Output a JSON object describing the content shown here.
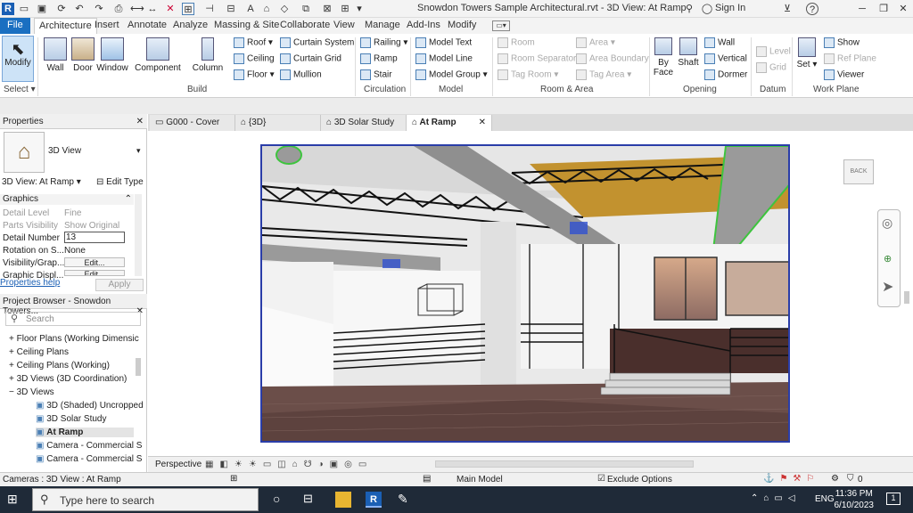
{
  "titlebar": {
    "title": "Snowdon Towers Sample Architectural.rvt - 3D View: At Ramp",
    "signin": "Sign In",
    "help": "?"
  },
  "tabs": [
    "File",
    "Architecture",
    "Insert",
    "Annotate",
    "Analyze",
    "Massing & Site",
    "Collaborate",
    "View",
    "Manage",
    "Add-Ins",
    "Modify"
  ],
  "ribbon": {
    "modify": "Modify",
    "select": "Select",
    "build": {
      "wall": "Wall",
      "door": "Door",
      "window": "Window",
      "component": "Component",
      "column": "Column",
      "roof": "Roof",
      "ceiling": "Ceiling",
      "floor": "Floor",
      "curtain_system": "Curtain System",
      "curtain_grid": "Curtain Grid",
      "mullion": "Mullion",
      "label": "Build"
    },
    "circulation": {
      "railing": "Railing",
      "ramp": "Ramp",
      "stair": "Stair",
      "label": "Circulation"
    },
    "model": {
      "text": "Model Text",
      "line": "Model Line",
      "group": "Model Group",
      "label": "Model"
    },
    "room": {
      "room": "Room",
      "separator": "Room Separator",
      "tag": "Tag Room",
      "area": "Area",
      "boundary": "Area Boundary",
      "tag_area": "Tag Area",
      "label": "Room & Area"
    },
    "opening": {
      "by_face_1": "By",
      "by_face_2": "Face",
      "shaft": "Shaft",
      "wall": "Wall",
      "vertical": "Vertical",
      "dormer": "Dormer",
      "label": "Opening"
    },
    "datum": {
      "level": "Level",
      "grid": "Grid",
      "label": "Datum"
    },
    "workplane": {
      "set": "Set",
      "show": "Show",
      "ref_plane": "Ref Plane",
      "viewer": "Viewer",
      "label": "Work Plane"
    }
  },
  "properties": {
    "title": "Properties",
    "type": "3D View",
    "selector": "3D View: At Ramp",
    "edit_type": "Edit Type",
    "group": "Graphics",
    "rows": [
      {
        "k": "Detail Level",
        "v": "Fine",
        "dim": true
      },
      {
        "k": "Parts Visibility",
        "v": "Show Original",
        "dim": true
      },
      {
        "k": "Detail Number",
        "v": "13",
        "dim": false
      },
      {
        "k": "Rotation on S...",
        "v": "None",
        "dim": false
      },
      {
        "k": "Visibility/Grap...",
        "v": "Edit...",
        "dim": false
      },
      {
        "k": "Graphic Displ...",
        "v": "Edit...",
        "dim": false
      }
    ],
    "help": "Properties help",
    "apply": "Apply"
  },
  "browser": {
    "title": "Project Browser - Snowdon Towers...",
    "search_placeholder": "Search",
    "items": [
      {
        "t": "+ Floor Plans (Working Dimensic",
        "indent": 0
      },
      {
        "t": "+ Ceiling Plans",
        "indent": 0
      },
      {
        "t": "+ Ceiling Plans (Working)",
        "indent": 0
      },
      {
        "t": "+ 3D Views (3D Coordination)",
        "indent": 0
      },
      {
        "t": "− 3D Views",
        "indent": 0
      },
      {
        "t": "3D (Shaded) Uncropped",
        "indent": 1
      },
      {
        "t": "3D Solar Study",
        "indent": 1
      },
      {
        "t": "At Ramp",
        "indent": 1
      },
      {
        "t": "Camera - Commercial S",
        "indent": 1
      },
      {
        "t": "Camera - Commercial S",
        "indent": 1
      }
    ]
  },
  "doctabs": [
    "G000 - Cover",
    "{3D}",
    "3D Solar Study",
    "At Ramp"
  ],
  "viewcube": "BACK",
  "viewbar": {
    "mode": "Perspective"
  },
  "status": {
    "left": "Cameras : 3D View : At Ramp",
    "model": "Main Model",
    "exclude": "Exclude Options",
    "filter": "0"
  },
  "taskbar": {
    "search_placeholder": "Type here to search",
    "lang": "ENG",
    "time": "11:36 PM",
    "date": "6/10/2023",
    "notif": "1"
  },
  "colors": {
    "file_tab": "#1a6fc1",
    "viewport_border": "#2a3da8",
    "taskbar": "#1f2a38"
  }
}
